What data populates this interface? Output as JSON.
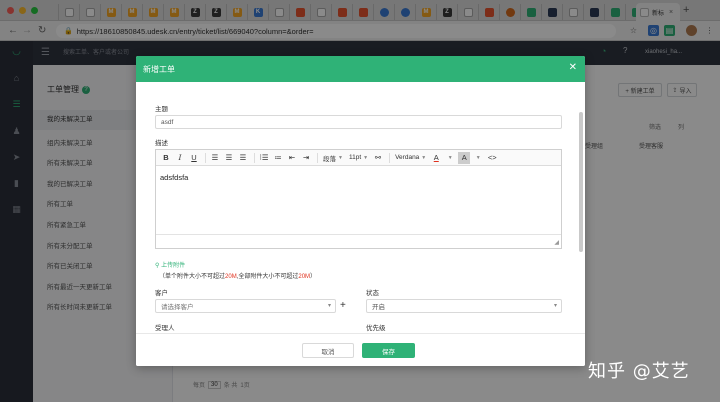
{
  "browser": {
    "url": "https://18610850845.udesk.cn/entry/ticket/list/669040?column=&order=",
    "active_tab_label": "新标",
    "tab_favicons": [
      {
        "icon": "page-icon",
        "color": "#ffffff",
        "glyph": "▢"
      },
      {
        "icon": "page-icon",
        "color": "#ffffff",
        "glyph": "▢"
      },
      {
        "icon": "m-icon",
        "color": "#f5a623",
        "glyph": "M"
      },
      {
        "icon": "m-icon",
        "color": "#f5a623",
        "glyph": "M"
      },
      {
        "icon": "m-icon",
        "color": "#f5a623",
        "glyph": "M"
      },
      {
        "icon": "m-icon",
        "color": "#f5a623",
        "glyph": "M"
      },
      {
        "icon": "z-icon",
        "color": "#3a3a3a",
        "glyph": "Z"
      },
      {
        "icon": "z-icon",
        "color": "#3a3a3a",
        "glyph": "Z"
      },
      {
        "icon": "m-icon",
        "color": "#f5a623",
        "glyph": "M"
      },
      {
        "icon": "kr-icon",
        "color": "#3a7bd5",
        "glyph": "K"
      },
      {
        "icon": "page-icon",
        "color": "#ffffff",
        "glyph": "▢"
      },
      {
        "icon": "red-icon",
        "color": "#e8542f",
        "glyph": "■"
      },
      {
        "icon": "page-icon",
        "color": "#ffffff",
        "glyph": "▢"
      },
      {
        "icon": "red-icon",
        "color": "#e8542f",
        "glyph": "■"
      },
      {
        "icon": "red-icon",
        "color": "#e8542f",
        "glyph": "■"
      },
      {
        "icon": "circle-icon",
        "color": "#3a7bd5",
        "glyph": "●"
      },
      {
        "icon": "circle-icon",
        "color": "#3a7bd5",
        "glyph": "●"
      },
      {
        "icon": "m-icon",
        "color": "#f5a623",
        "glyph": "M"
      },
      {
        "icon": "z-icon",
        "color": "#3a3a3a",
        "glyph": "Z"
      },
      {
        "icon": "page-icon",
        "color": "#ffffff",
        "glyph": "▢"
      },
      {
        "icon": "red-icon",
        "color": "#e8542f",
        "glyph": "■"
      },
      {
        "icon": "circle-icon",
        "color": "#d26a1e",
        "glyph": "●"
      },
      {
        "icon": "green-icon",
        "color": "#2fb277",
        "glyph": "■"
      },
      {
        "icon": "dark-icon",
        "color": "#2b3a55",
        "glyph": "■"
      },
      {
        "icon": "page-icon",
        "color": "#ffffff",
        "glyph": "▢"
      },
      {
        "icon": "dark-icon",
        "color": "#2b3a55",
        "glyph": "■"
      },
      {
        "icon": "green-icon",
        "color": "#2fb277",
        "glyph": "■"
      },
      {
        "icon": "green-icon",
        "color": "#2fb277",
        "glyph": "■"
      }
    ]
  },
  "app": {
    "search_placeholder": "搜索工单、客户或者公司",
    "user_name": "xiaohesi_ha...",
    "panel_title": "工单管理",
    "nav_items": [
      "我的未解决工单",
      "组内未解决工单",
      "所有未解决工单",
      "我的已解决工单",
      "所有工单",
      "所有紧急工单",
      "所有未分配工单",
      "所有已关闭工单",
      "所有最近一天更新工单",
      "所有长时间未更新工单"
    ],
    "btn_new_ticket": "+ 新建工单",
    "btn_import": "导入",
    "filter_label": "筛选",
    "columns_label": "列",
    "col_group": "受理组",
    "col_assignee": "受理客服",
    "pager_prefix": "每页",
    "pager_size": "30",
    "pager_total": "条  共",
    "pager_suffix": "1页"
  },
  "modal": {
    "title": "新增工单",
    "subject_label": "主题",
    "subject_value": "asdf",
    "desc_label": "描述",
    "toolbar": {
      "paragraph": "段落",
      "font_size": "11pt",
      "font_family": "Verdana"
    },
    "editor_text": "adsfdsfa",
    "upload_label": "上传附件",
    "note_pre": "（单个附件大小不可超过",
    "note_size1": "20M",
    "note_mid": ",全部附件大小不可超过",
    "note_size2": "20M",
    "note_post": "）",
    "customer_label": "客户",
    "customer_placeholder": "请选择客户",
    "status_label": "状态",
    "status_value": "开启",
    "assignee_label": "受理人",
    "priority_label": "优先级",
    "cancel_label": "取消",
    "save_label": "保存"
  },
  "watermark": "知乎 @艾艺",
  "colors": {
    "accent": "#2fb277",
    "sidebar": "#2b2f3a",
    "warning_red": "#e0311e"
  }
}
